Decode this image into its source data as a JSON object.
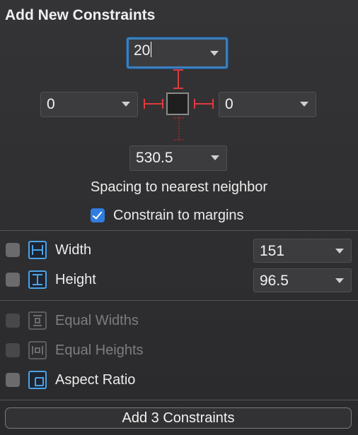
{
  "panel": {
    "title": "Add New Constraints",
    "top_value": "20",
    "left_value": "0",
    "right_value": "0",
    "bottom_value": "530.5",
    "spacing_label": "Spacing to nearest neighbor",
    "margins_label": "Constrain to margins",
    "margins_checked": true
  },
  "size": {
    "width_label": "Width",
    "width_value": "151",
    "height_label": "Height",
    "height_value": "96.5"
  },
  "equal": {
    "equal_widths_label": "Equal Widths",
    "equal_heights_label": "Equal Heights",
    "aspect_ratio_label": "Aspect Ratio"
  },
  "footer": {
    "add_button_label": "Add 3 Constraints"
  },
  "colors": {
    "accent": "#2f7de1",
    "constraint_red": "#e0393e",
    "icon_blue": "#4aa3e8"
  }
}
